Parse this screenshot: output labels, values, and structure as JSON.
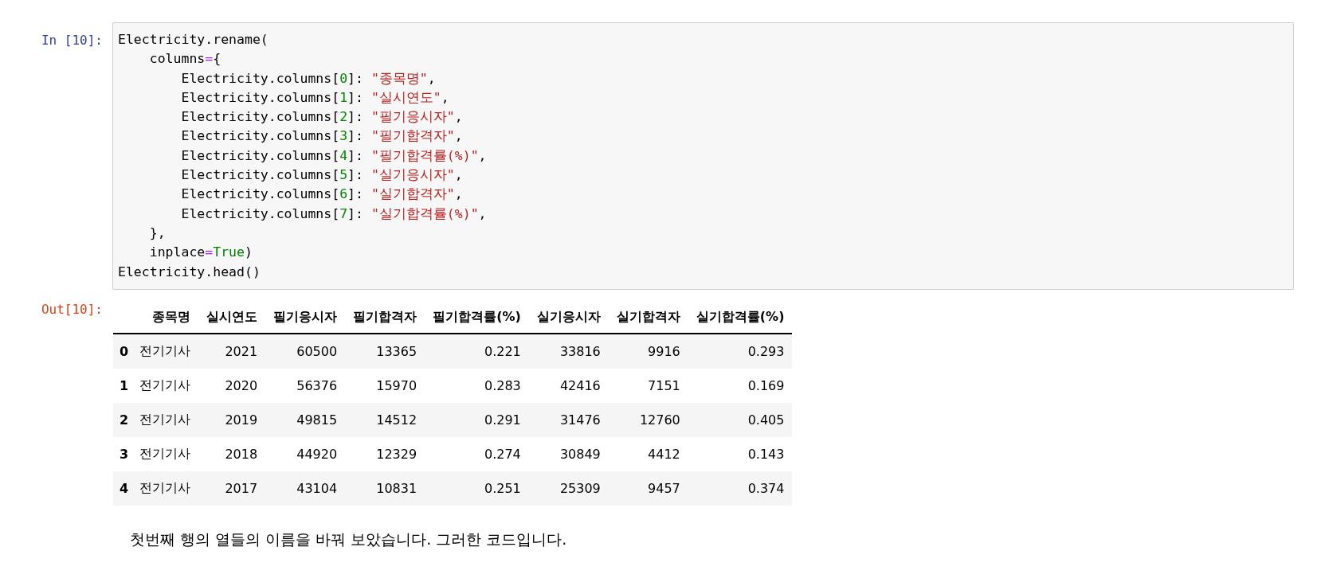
{
  "input_cell": {
    "prompt": "In [10]:",
    "code_lines": [
      [
        {
          "kind": "plain",
          "text": "Electricity.rename("
        }
      ],
      [
        {
          "kind": "plain",
          "text": "    columns"
        },
        {
          "kind": "operator",
          "text": "="
        },
        {
          "kind": "plain",
          "text": "{"
        }
      ],
      [
        {
          "kind": "plain",
          "text": "        Electricity.columns["
        },
        {
          "kind": "number",
          "text": "0"
        },
        {
          "kind": "plain",
          "text": "]: "
        },
        {
          "kind": "string",
          "text": "\"종목명\""
        },
        {
          "kind": "plain",
          "text": ","
        }
      ],
      [
        {
          "kind": "plain",
          "text": "        Electricity.columns["
        },
        {
          "kind": "number",
          "text": "1"
        },
        {
          "kind": "plain",
          "text": "]: "
        },
        {
          "kind": "string",
          "text": "\"실시연도\""
        },
        {
          "kind": "plain",
          "text": ","
        }
      ],
      [
        {
          "kind": "plain",
          "text": "        Electricity.columns["
        },
        {
          "kind": "number",
          "text": "2"
        },
        {
          "kind": "plain",
          "text": "]: "
        },
        {
          "kind": "string",
          "text": "\"필기응시자\""
        },
        {
          "kind": "plain",
          "text": ","
        }
      ],
      [
        {
          "kind": "plain",
          "text": "        Electricity.columns["
        },
        {
          "kind": "number",
          "text": "3"
        },
        {
          "kind": "plain",
          "text": "]: "
        },
        {
          "kind": "string",
          "text": "\"필기합격자\""
        },
        {
          "kind": "plain",
          "text": ","
        }
      ],
      [
        {
          "kind": "plain",
          "text": "        Electricity.columns["
        },
        {
          "kind": "number",
          "text": "4"
        },
        {
          "kind": "plain",
          "text": "]: "
        },
        {
          "kind": "string",
          "text": "\"필기합격률(%)\""
        },
        {
          "kind": "plain",
          "text": ","
        }
      ],
      [
        {
          "kind": "plain",
          "text": "        Electricity.columns["
        },
        {
          "kind": "number",
          "text": "5"
        },
        {
          "kind": "plain",
          "text": "]: "
        },
        {
          "kind": "string",
          "text": "\"실기응시자\""
        },
        {
          "kind": "plain",
          "text": ","
        }
      ],
      [
        {
          "kind": "plain",
          "text": "        Electricity.columns["
        },
        {
          "kind": "number",
          "text": "6"
        },
        {
          "kind": "plain",
          "text": "]: "
        },
        {
          "kind": "string",
          "text": "\"실기합격자\""
        },
        {
          "kind": "plain",
          "text": ","
        }
      ],
      [
        {
          "kind": "plain",
          "text": "        Electricity.columns["
        },
        {
          "kind": "number",
          "text": "7"
        },
        {
          "kind": "plain",
          "text": "]: "
        },
        {
          "kind": "string",
          "text": "\"실기합격률(%)\""
        },
        {
          "kind": "plain",
          "text": ","
        }
      ],
      [
        {
          "kind": "plain",
          "text": "    },"
        }
      ],
      [
        {
          "kind": "plain",
          "text": "    inplace"
        },
        {
          "kind": "operator",
          "text": "="
        },
        {
          "kind": "keyword",
          "text": "True"
        },
        {
          "kind": "plain",
          "text": ")"
        }
      ],
      [
        {
          "kind": "plain",
          "text": "Electricity.head()"
        }
      ]
    ]
  },
  "output_cell": {
    "prompt": "Out[10]:",
    "table": {
      "columns": [
        "종목명",
        "실시연도",
        "필기응시자",
        "필기합격자",
        "필기합격률(%)",
        "실기응시자",
        "실기합격자",
        "실기합격률(%)"
      ],
      "rows": [
        {
          "index": "0",
          "cells": [
            "전기기사",
            "2021",
            "60500",
            "13365",
            "0.221",
            "33816",
            "9916",
            "0.293"
          ]
        },
        {
          "index": "1",
          "cells": [
            "전기기사",
            "2020",
            "56376",
            "15970",
            "0.283",
            "42416",
            "7151",
            "0.169"
          ]
        },
        {
          "index": "2",
          "cells": [
            "전기기사",
            "2019",
            "49815",
            "14512",
            "0.291",
            "31476",
            "12760",
            "0.405"
          ]
        },
        {
          "index": "3",
          "cells": [
            "전기기사",
            "2018",
            "44920",
            "12329",
            "0.274",
            "30849",
            "4412",
            "0.143"
          ]
        },
        {
          "index": "4",
          "cells": [
            "전기기사",
            "2017",
            "43104",
            "10831",
            "0.251",
            "25309",
            "9457",
            "0.374"
          ]
        }
      ]
    }
  },
  "markdown_cell": {
    "text": "첫번째 행의 열들의 이름을 바꿔 보았습니다. 그러한 코드입니다."
  }
}
